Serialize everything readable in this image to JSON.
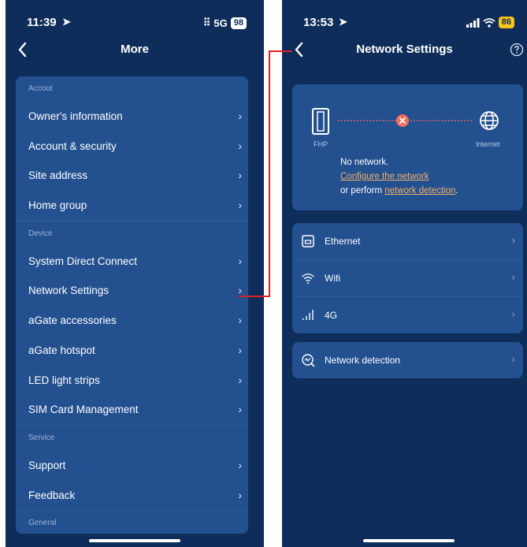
{
  "left_screen": {
    "status": {
      "time": "11:39",
      "network": "5G",
      "battery": "98"
    },
    "title": "More",
    "sections": [
      {
        "label": "Accout",
        "items": [
          "Owner's information",
          "Account & security",
          "Site address",
          "Home group"
        ]
      },
      {
        "label": "Device",
        "items": [
          "System Direct Connect",
          "Network Settings",
          "aGate accessories",
          "aGate hotspot",
          "LED light strips",
          "SIM Card Management"
        ]
      },
      {
        "label": "Service",
        "items": [
          "Support",
          "Feedback"
        ]
      },
      {
        "label": "General",
        "items": []
      }
    ]
  },
  "right_screen": {
    "status": {
      "time": "13:53",
      "battery": "86"
    },
    "title": "Network Settings",
    "diagram": {
      "device_label": "FHP",
      "internet_label": "Internet",
      "no_network_text": "No network.",
      "configure_link": "Configure the network",
      "perform_prefix": "or perform ",
      "detection_link": "network detection",
      "period": "."
    },
    "network_options": [
      {
        "label": "Ethernet",
        "icon": "ethernet-icon"
      },
      {
        "label": "Wifi",
        "icon": "wifi-icon"
      },
      {
        "label": "4G",
        "icon": "cellular-icon"
      }
    ],
    "detection_row": {
      "label": "Network detection",
      "icon": "detection-icon"
    }
  },
  "colors": {
    "background": "#0f2d5a",
    "card": "#23508f",
    "link": "#f3b06b",
    "connector": "#e02020",
    "battery_left": "#ffffff",
    "battery_right": "#f5c518",
    "error": "#f26d5b"
  }
}
